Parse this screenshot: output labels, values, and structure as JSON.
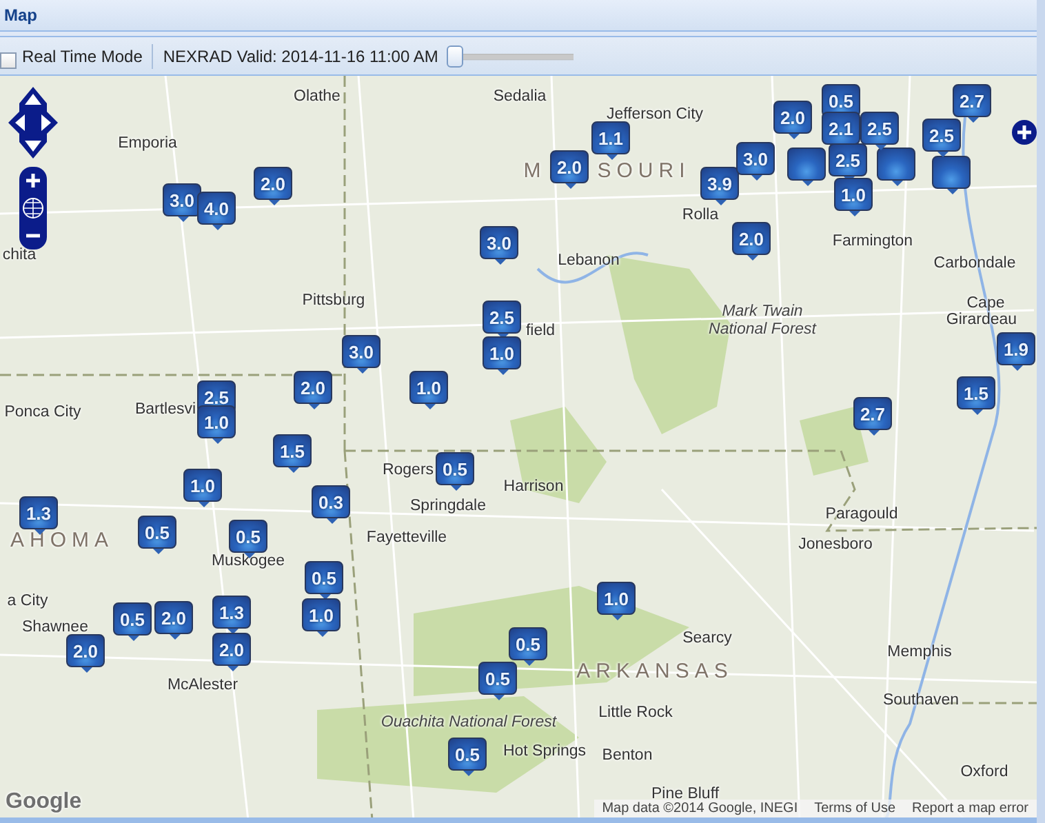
{
  "panel": {
    "title": "Map"
  },
  "toolbar": {
    "real_time_mode": {
      "label": "Real Time Mode",
      "checked": false
    },
    "nexrad_label": "NEXRAD Valid: 2014-11-16 11:00 AM",
    "time_slider": {
      "level": 0
    }
  },
  "map": {
    "places": [
      {
        "name": "Olathe",
        "kind": "city"
      },
      {
        "name": "Sedalia",
        "kind": "city"
      },
      {
        "name": "Jefferson City",
        "kind": "city"
      },
      {
        "name": "Emporia",
        "kind": "city"
      },
      {
        "name": "chita",
        "kind": "city"
      },
      {
        "name": "M",
        "kind": "state"
      },
      {
        "name": "SOURI",
        "kind": "state"
      },
      {
        "name": "Rolla",
        "kind": "city"
      },
      {
        "name": "Lebanon",
        "kind": "city"
      },
      {
        "name": "Farmington",
        "kind": "city"
      },
      {
        "name": "Carbondale",
        "kind": "city"
      },
      {
        "name": "Mark Twain",
        "kind": "forest"
      },
      {
        "name": "National Forest",
        "kind": "forest"
      },
      {
        "name": "Cape",
        "kind": "city"
      },
      {
        "name": "Girardeau",
        "kind": "city"
      },
      {
        "name": "Pittsburg",
        "kind": "city"
      },
      {
        "name": "field",
        "kind": "city"
      },
      {
        "name": "Bartlesvi",
        "kind": "city"
      },
      {
        "name": "Ponca City",
        "kind": "city"
      },
      {
        "name": "Rogers",
        "kind": "city"
      },
      {
        "name": "Springdale",
        "kind": "city"
      },
      {
        "name": "Harrison",
        "kind": "city"
      },
      {
        "name": "Paragould",
        "kind": "city"
      },
      {
        "name": "AHOMA",
        "kind": "state"
      },
      {
        "name": "Fayetteville",
        "kind": "city"
      },
      {
        "name": "Jonesboro",
        "kind": "city"
      },
      {
        "name": "Muskogee",
        "kind": "city"
      },
      {
        "name": "a City",
        "kind": "city"
      },
      {
        "name": "Shawnee",
        "kind": "city"
      },
      {
        "name": "McAlester",
        "kind": "city"
      },
      {
        "name": "Searcy",
        "kind": "city"
      },
      {
        "name": "Memphis",
        "kind": "city"
      },
      {
        "name": "ARKANSAS",
        "kind": "state"
      },
      {
        "name": "Southaven",
        "kind": "city"
      },
      {
        "name": "Little Rock",
        "kind": "city"
      },
      {
        "name": "Ouachita National Forest",
        "kind": "forest"
      },
      {
        "name": "Hot Springs",
        "kind": "city"
      },
      {
        "name": "Benton",
        "kind": "city"
      },
      {
        "name": "Pine Bluff",
        "kind": "city"
      },
      {
        "name": "Oxford",
        "kind": "city"
      }
    ],
    "markers": [
      {
        "value": "3.0"
      },
      {
        "value": "4.0"
      },
      {
        "value": "2.0"
      },
      {
        "value": "2.0"
      },
      {
        "value": "1.1"
      },
      {
        "value": "3.9"
      },
      {
        "value": "3.0"
      },
      {
        "value": "2.0"
      },
      {
        "value": "0.5"
      },
      {
        "value": "2.1"
      },
      {
        "value": "2.5"
      },
      {
        "value": "1.0"
      },
      {
        "value": "2.5"
      },
      {
        "value": "2.5"
      },
      {
        "value": "2.7"
      },
      {
        "value": "3.0"
      },
      {
        "value": "2.0"
      },
      {
        "value": "3.0"
      },
      {
        "value": "2.5"
      },
      {
        "value": "1.0"
      },
      {
        "value": "1.9"
      },
      {
        "value": "2.5"
      },
      {
        "value": "1.0"
      },
      {
        "value": "2.0"
      },
      {
        "value": "1.0"
      },
      {
        "value": "2.7"
      },
      {
        "value": "1.5"
      },
      {
        "value": "1.3"
      },
      {
        "value": "0.5"
      },
      {
        "value": "1.0"
      },
      {
        "value": "0.5"
      },
      {
        "value": "1.5"
      },
      {
        "value": "0.3"
      },
      {
        "value": "0.5"
      },
      {
        "value": "2.0"
      },
      {
        "value": "0.5"
      },
      {
        "value": "2.0"
      },
      {
        "value": "1.3"
      },
      {
        "value": "2.0"
      },
      {
        "value": "0.5"
      },
      {
        "value": "1.0"
      },
      {
        "value": "0.5"
      },
      {
        "value": "1.0"
      },
      {
        "value": "0.5"
      },
      {
        "value": "0.5"
      }
    ],
    "logo": "Google",
    "attribution": {
      "map_data": "Map data ©2014 Google, INEGI",
      "terms": "Terms of Use",
      "report": "Report a map error"
    }
  }
}
